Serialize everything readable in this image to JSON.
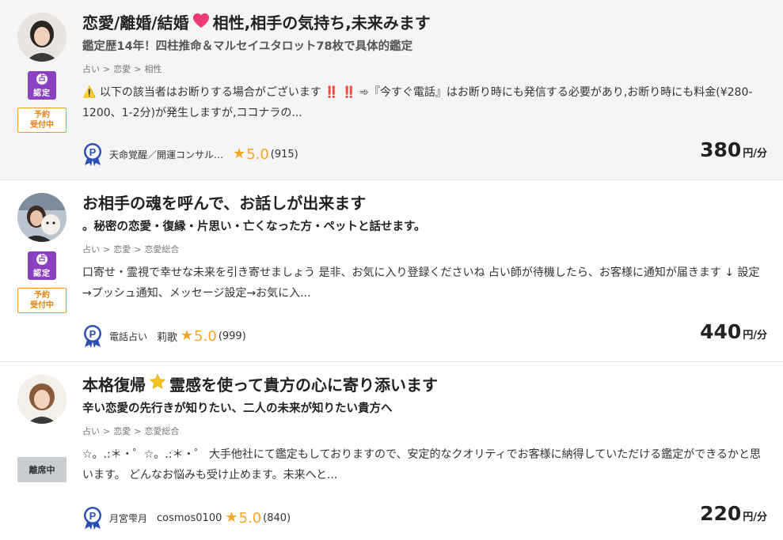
{
  "listings": [
    {
      "title_a": "恋愛/離婚/結婚",
      "title_emoji": "heart",
      "title_b": "相性,相手の気持ち,未来みます",
      "subtitle": "鑑定歴14年！四柱推命＆マルセイユタロット78枚で具体的鑑定",
      "crumbs": [
        "占い",
        "恋愛",
        "相性"
      ],
      "desc": "⚠️ 以下の該当者はお断りする場合がございます ‼️ ‼️ ➾『今すぐ電話』はお断り時にも発信する必要があり,お断り時にも料金(¥280-1200、1-2分)が発生しますが,ココナラの...",
      "cert_top": "占",
      "cert_bottom": "認定",
      "status": "予約\n受付中",
      "seller": "天命覚醒／開運コンサル…",
      "seller_sub": "",
      "rating": "5.0",
      "count": "(915)",
      "price": "380",
      "unit": "円/分"
    },
    {
      "title_a": "お相手の魂を呼んで、お話しが出来ます",
      "title_emoji": "",
      "title_b": "",
      "subtitle": "。秘密の恋愛・復縁・片思い・亡くなった方・ペットと話せます。",
      "crumbs": [
        "占い",
        "恋愛",
        "恋愛総合"
      ],
      "desc": "口寄せ・霊視で幸せな未来を引き寄せましょう 是非、お気に入り登録くださいね 占い師が待機したら、お客様に通知が届きます ↓ 設定→プッシュ通知、メッセージ設定→お気に入...",
      "cert_top": "占",
      "cert_bottom": "認定",
      "status": "予約\n受付中",
      "seller": "電話占い",
      "seller_sub": "莉歌",
      "rating": "5.0",
      "count": "(999)",
      "price": "440",
      "unit": "円/分"
    },
    {
      "title_a": "本格復帰",
      "title_emoji": "star",
      "title_b": "霊感を使って貴方の心に寄り添います",
      "subtitle": "辛い恋愛の先行きが知りたい、二人の未来が知りたい貴方へ",
      "crumbs": [
        "占い",
        "恋愛",
        "恋愛総合"
      ],
      "desc": "☆。.:＊・゜☆。.:＊・゜ 大手他社にて鑑定もしておりますので、安定的なクオリティでお客様に納得していただける鑑定ができるかと思います。 どんなお悩みも受け止めます。未来へと...",
      "cert_top": "",
      "cert_bottom": "",
      "status": "離席中",
      "seller": "月宮雫月",
      "seller_sub": "cosmos0100",
      "rating": "5.0",
      "count": "(840)",
      "price": "220",
      "unit": "円/分"
    }
  ],
  "colors": {
    "cert_purple": "#8b3fc1",
    "reserve_orange": "#e8830c",
    "star_gold": "#f5a623",
    "badge_blue": "#2d4fb3"
  }
}
